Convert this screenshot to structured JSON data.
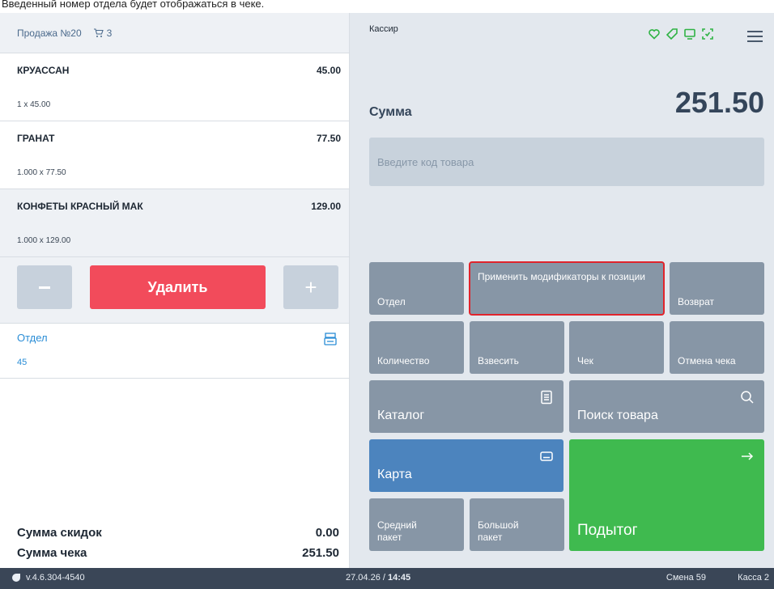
{
  "caption": "Введенный номер отдела будет отображаться в чеке.",
  "sale": {
    "title": "Продажа №20",
    "cart_count": "3",
    "items": [
      {
        "name": "КРУАССАН",
        "price": "45.00",
        "qty": "1 x 45.00"
      },
      {
        "name": "ГРАНАТ",
        "price": "77.50",
        "qty": "1.000 x 77.50"
      },
      {
        "name": "КОНФЕТЫ КРАСНЫЙ МАК",
        "price": "129.00",
        "qty": "1.000 x 129.00"
      }
    ],
    "delete_label": "Удалить",
    "plus_label": "+",
    "department_label": "Отдел",
    "department_value": "45",
    "discount_label": "Сумма скидок",
    "discount_value": "0.00",
    "total_label": "Сумма чека",
    "total_value": "251.50"
  },
  "register": {
    "cashier_label": "Кассир",
    "sum_label": "Сумма",
    "sum_value": "251.50",
    "code_placeholder": "Введите код товара",
    "tiles": {
      "department": "Отдел",
      "modifiers": "Применить модификаторы к позиции",
      "return": "Возврат",
      "quantity": "Количество",
      "weigh": "Взвесить",
      "receipt": "Чек",
      "cancel_receipt": "Отмена чека",
      "catalog": "Каталог",
      "search": "Поиск товара",
      "card": "Карта",
      "medium_bag": "Средний пакет",
      "large_bag": "Большой пакет",
      "subtotal": "Подытог"
    },
    "icons": [
      "heart-icon",
      "tag-icon",
      "monitor-icon",
      "scan-icon",
      "menu-icon"
    ],
    "colors": {
      "delete": "#f24b5b",
      "card": "#4c84be",
      "subtotal": "#3fba4f",
      "accent": "#2a8dd6",
      "icons": "#2fb344"
    }
  },
  "statusbar": {
    "version": "v.4.6.304-4540",
    "date": "27.04.26 / ",
    "time": "14:45",
    "shift": "Смена 59",
    "kassa": "Касса 2"
  }
}
